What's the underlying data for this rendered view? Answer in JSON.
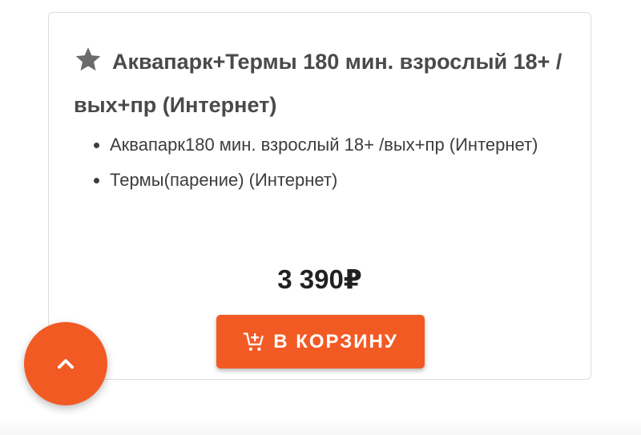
{
  "product": {
    "title": "Аквапарк+Термы 180 мин. взрослый 18+ /вых+пр (Интернет)",
    "title_icon": "star-icon",
    "includes": [
      "Аквапарк180 мин. взрослый 18+ /вых+пр (Интернет)",
      "Термы(парение) (Интернет)"
    ],
    "price": "3 390₽"
  },
  "actions": {
    "add_to_cart_label": "В КОРЗИНУ",
    "add_to_cart_icon": "add-to-cart-icon",
    "scroll_top_icon": "chevron-up-icon"
  },
  "colors": {
    "accent": "#f25a24",
    "text": "#424242",
    "price": "#212121",
    "card_border": "#dedede",
    "icon_grey": "#6b6b6b"
  }
}
